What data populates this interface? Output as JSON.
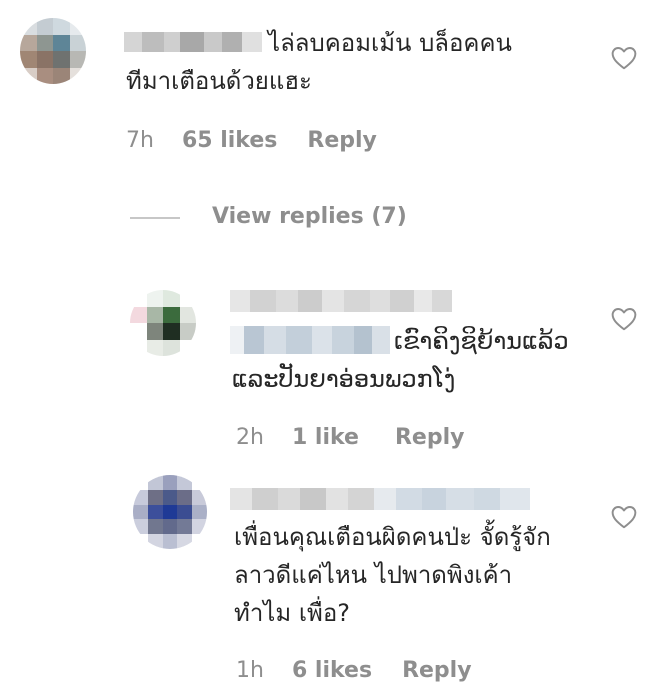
{
  "comments": [
    {
      "lines": [
        "ไล่ลบคอมเม้น บล็อคคน",
        "ทีมาเตือนด้วยแฮะ"
      ],
      "time": "7h",
      "likes": "65 likes",
      "reply": "Reply"
    },
    {
      "lines": [
        "ເຂົາຄິງຊິຍ້ານແລ້ວ",
        "ແລະປັນຍາອ່ອນພວກໂງ່"
      ],
      "time": "2h",
      "likes": "1 like",
      "reply": "Reply"
    },
    {
      "lines": [
        "เพื่อนคุณเตือนผิดคนป่ะ จั้ดรู้จัก",
        "ลาวดีแค่ไหน ไปพาดพิงเค้า",
        "ทำไม เพื่อ?"
      ],
      "time": "1h",
      "likes": "6 likes",
      "reply": "Reply"
    }
  ],
  "view_replies": "View replies (7)",
  "icons": {
    "like": "heart-outline-icon"
  },
  "colors": {
    "muted": "#8e8e8e",
    "text": "#262626",
    "heart": "#8e8e8e"
  }
}
